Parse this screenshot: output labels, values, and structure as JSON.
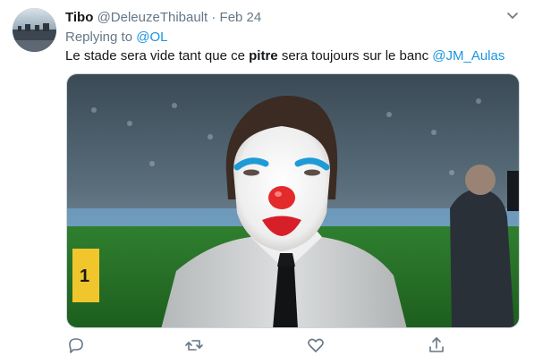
{
  "tweet": {
    "display_name": "Tibo",
    "handle": "@DeleuzeThibault",
    "separator": "·",
    "date": "Feb 24",
    "replying_prefix": "Replying to",
    "replying_to": "@OL",
    "text_before": "Le stade sera vide tant que ce ",
    "text_bold": "pitre",
    "text_middle": " sera toujours sur le banc ",
    "text_mention": "@JM_Aulas"
  },
  "icons": [
    "user-avatar",
    "chevron-down-icon",
    "reply-icon",
    "retweet-icon",
    "like-icon",
    "share-icon"
  ],
  "colors": {
    "link": "#1b95e0",
    "secondary_text": "#657786",
    "primary_text": "#14171a"
  }
}
